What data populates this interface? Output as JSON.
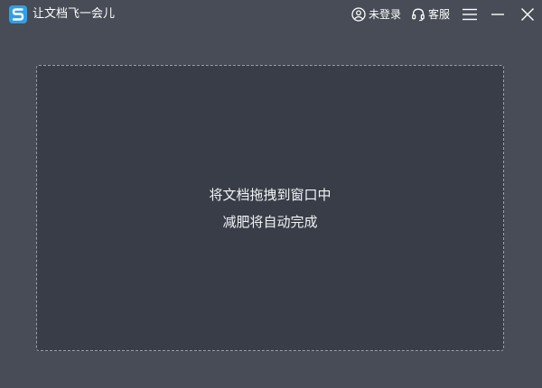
{
  "app": {
    "title": "让文档飞一会儿",
    "logo_icon": "app-logo-icon",
    "logo_color": "#2f9fe6"
  },
  "header": {
    "login": {
      "icon": "user-circle-icon",
      "label": "未登录"
    },
    "service": {
      "icon": "headset-icon",
      "label": "客服"
    },
    "window_controls": {
      "menu_icon": "hamburger-menu-icon",
      "minimize_icon": "minimize-icon",
      "close_icon": "close-icon"
    }
  },
  "drop_zone": {
    "line1": "将文档拖拽到窗口中",
    "line2": "减肥将自动完成"
  },
  "colors": {
    "window_background": "#474c56",
    "drop_zone_background": "#383d48",
    "drop_zone_border": "#9aa0a8",
    "text": "#ffffff"
  }
}
